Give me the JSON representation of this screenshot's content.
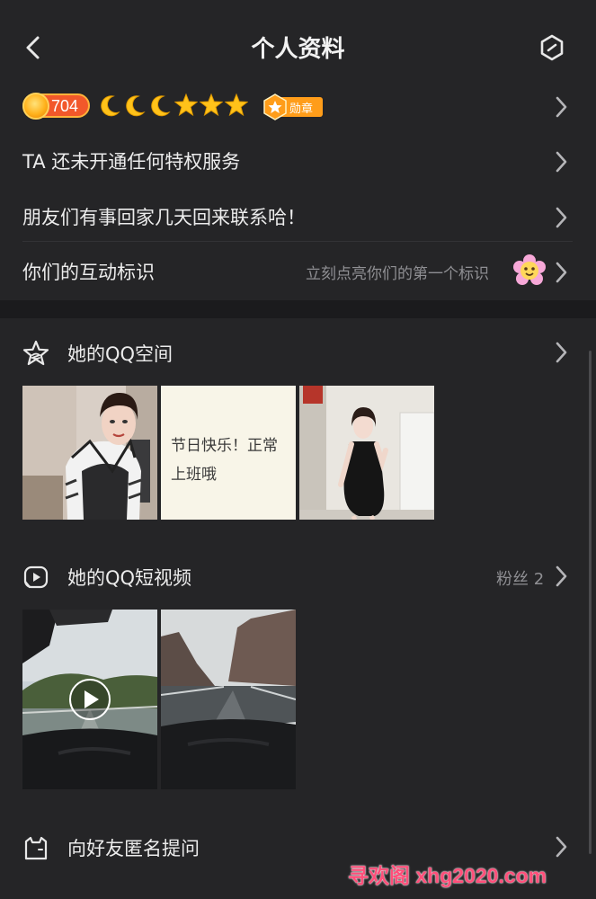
{
  "header": {
    "title": "个人资料"
  },
  "profile": {
    "level": "704",
    "level_icons": [
      "moon-icon",
      "moon-icon",
      "moon-icon",
      "star-icon",
      "star-icon",
      "star-icon"
    ],
    "medal_label": "勋章",
    "privilege_text": "TA 还未开通任何特权服务",
    "signature": "朋友们有事回家几天回来联系哈！",
    "interaction_label": "你们的互动标识",
    "interaction_hint": "立刻点亮你们的第一个标识"
  },
  "qzone": {
    "title": "她的QQ空间",
    "text_post": [
      "节日快乐！正常",
      "上班哦"
    ]
  },
  "short_video": {
    "title": "她的QQ短视频",
    "followers": "粉丝 2"
  },
  "ask": {
    "title": "向好友匿名提问"
  },
  "watermark": "寻欢阁 xhg2020.com",
  "colors": {
    "background": "#252527",
    "accent_orange": "#ff9d1a",
    "badge_red": "#f2582a",
    "watermark": "#ff4f7a"
  }
}
